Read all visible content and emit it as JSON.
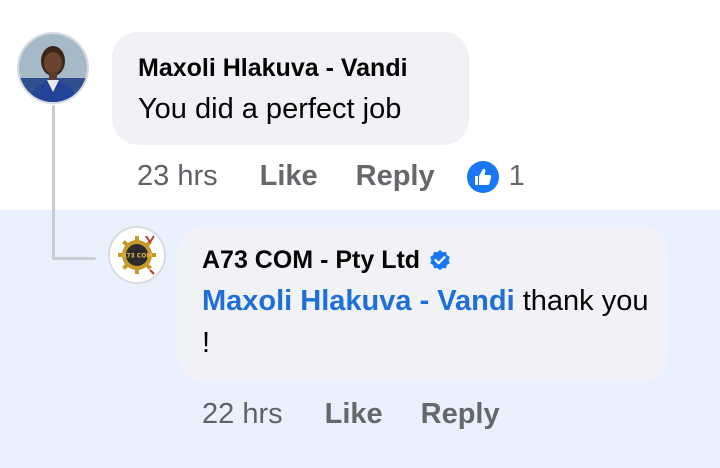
{
  "comment": {
    "author": "Maxoli Hlakuva - Vandi",
    "text": "You did a perfect job",
    "time": "23 hrs",
    "like_label": "Like",
    "reply_label": "Reply",
    "reaction_icon": "thumbs-up-icon",
    "reaction_count": "1"
  },
  "reply": {
    "author": "A73 COM - Pty Ltd",
    "verified_icon": "verified-badge-icon",
    "mention": "Maxoli Hlakuva - Vandi",
    "text": " thank you !",
    "time": "22 hrs",
    "like_label": "Like",
    "reply_label": "Reply",
    "logo_text": "A73 COM"
  },
  "colors": {
    "highlight": "#e8f1fd",
    "bubble": "#f0f2f5",
    "mention": "#1f6fd6",
    "like_badge": "#1877f2",
    "verified": "#1877f2"
  }
}
